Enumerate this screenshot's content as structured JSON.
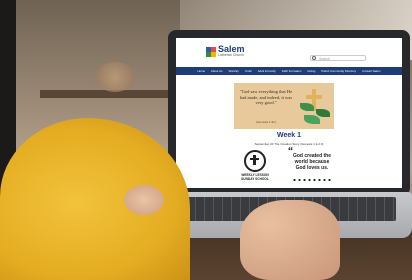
{
  "site": {
    "logo_title": "Salem",
    "logo_subtitle": "Lutheran Church",
    "search_placeholder": "Search",
    "nav_items": [
      "Home",
      "About Us",
      "Worship",
      "Youth",
      "Adult & Family",
      "Faith Formation",
      "Giving",
      "Parish Community Directory",
      "Contact Salem"
    ]
  },
  "banner": {
    "quote": "\"God saw everything that He had made, and indeed, it was very good.\"",
    "citation": "(Genesis 1:31)"
  },
  "content": {
    "week_title": "Week 1",
    "week_subtitle": "September 20 The Creation Story (Genesis 1:1-2:3)",
    "weekly_label_line1": "WEEKLY LESSON",
    "weekly_label_line2": "SUNDAY SCHOOL",
    "quote_mark": "“",
    "god_text": "God created the world because God loves us."
  },
  "colors": {
    "nav_bg": "#1d3c78",
    "banner_bg": "#e8c99b",
    "shirt": "#f2c33c"
  }
}
